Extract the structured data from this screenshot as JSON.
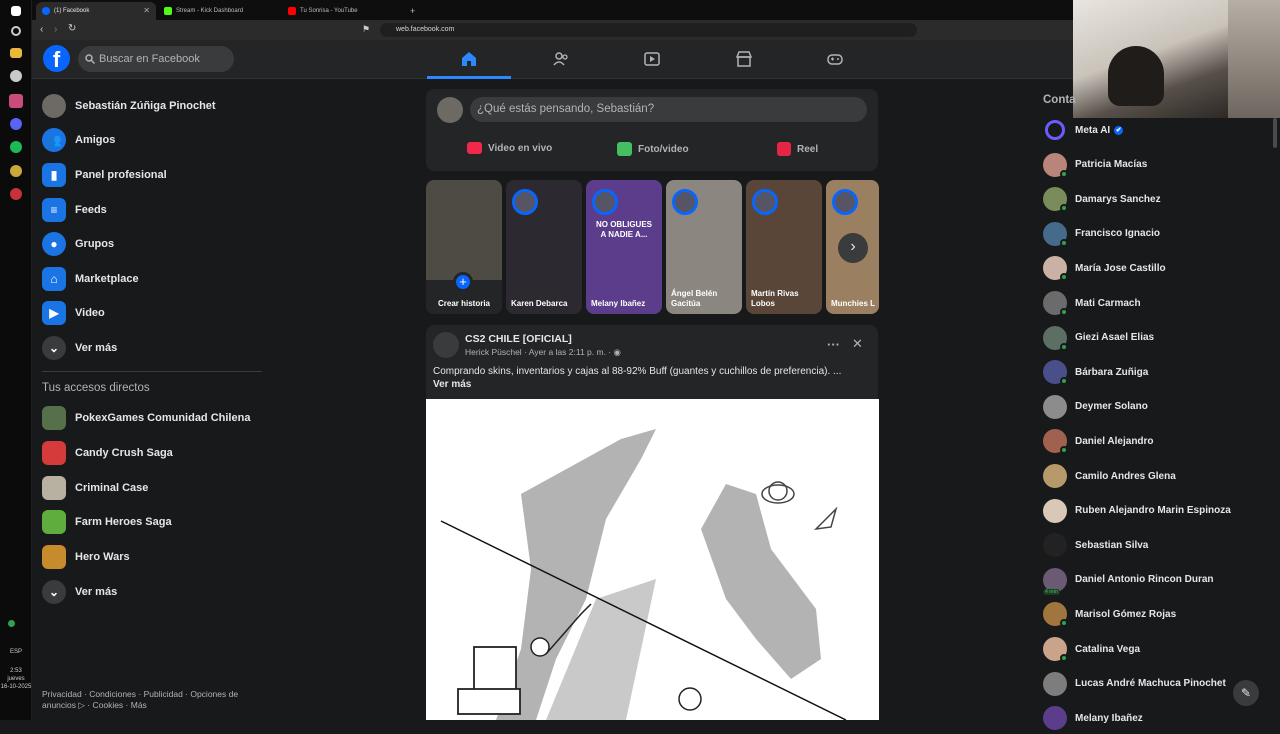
{
  "taskbar": {
    "lang": "ESP",
    "time": "2:53",
    "day": "jueves",
    "date": "16-10-2025"
  },
  "browser": {
    "tabs": [
      {
        "label": "(1) Facebook",
        "color": "#0866ff"
      },
      {
        "label": "Stream - Kick Dashboard",
        "color": "#53fc18"
      },
      {
        "label": "Tu Sonrisa - YouTube",
        "color": "#ff0000"
      }
    ],
    "new_tab": "+",
    "url": "web.facebook.com"
  },
  "header": {
    "logo": "f",
    "search_placeholder": "Buscar en Facebook"
  },
  "left": {
    "items": [
      {
        "label": "Sebastián Zúñiga Pinochet",
        "icon": "avatar",
        "color": "#6d6a64"
      },
      {
        "label": "Amigos",
        "icon": "friends-icon",
        "color": "#1b74e4"
      },
      {
        "label": "Panel profesional",
        "icon": "dashboard-icon",
        "color": "#1b74e4"
      },
      {
        "label": "Feeds",
        "icon": "feeds-icon",
        "color": "#1b74e4"
      },
      {
        "label": "Grupos",
        "icon": "groups-icon",
        "color": "#1b74e4"
      },
      {
        "label": "Marketplace",
        "icon": "marketplace-icon",
        "color": "#1b74e4"
      },
      {
        "label": "Video",
        "icon": "video-icon",
        "color": "#1b74e4"
      },
      {
        "label": "Ver más",
        "icon": "chevron-down-icon",
        "color": "#3a3b3c"
      }
    ],
    "shortcuts_title": "Tus accesos directos",
    "shortcuts": [
      {
        "label": "PokexGames Comunidad Chilena",
        "color": "#55704a"
      },
      {
        "label": "Candy Crush Saga",
        "color": "#d63b3b"
      },
      {
        "label": "Criminal Case",
        "color": "#b8b0a0"
      },
      {
        "label": "Farm Heroes Saga",
        "color": "#5fae3d"
      },
      {
        "label": "Hero Wars",
        "color": "#c78a2d"
      },
      {
        "label": "Ver más",
        "color": "#3a3b3c"
      }
    ],
    "footer": "Privacidad · Condiciones · Publicidad · Opciones de anuncios ▷ · Cookies · Más"
  },
  "composer": {
    "placeholder": "¿Qué estás pensando, Sebastián?",
    "buttons": [
      {
        "label": "Video en vivo",
        "color": "#f02849"
      },
      {
        "label": "Foto/video",
        "color": "#45bd62"
      },
      {
        "label": "Reel",
        "color": "#e42645"
      }
    ]
  },
  "stories": [
    {
      "label": "Crear historia",
      "color": "#4e4a44"
    },
    {
      "label": "Karen Debarca",
      "color": "#2c2a30"
    },
    {
      "label": "Melany Ibañez",
      "color": "#5b3d8c",
      "overlay": "NO OBLIGUES A NADIE A..."
    },
    {
      "label": "Ángel Belén Gacitúa",
      "color": "#8b8680"
    },
    {
      "label": "Martín Rivas Lobos",
      "color": "#5a4638"
    },
    {
      "label": "Munchies L",
      "color": "#9a8060"
    }
  ],
  "post": {
    "page": "CS2 CHILE [OFICIAL]",
    "meta": "Herick Püschel · Ayer a las 2:11 p. m. · ",
    "text": "Comprando skins, inventarios y cajas al 88-92% Buff (guantes y cuchillos de preferencia). ...",
    "more": "Ver más"
  },
  "contacts": {
    "title": "Conta",
    "list": [
      {
        "name": "Meta AI",
        "color": "#6b5cff",
        "online": false
      },
      {
        "name": "Patricia Macías",
        "color": "#b9857a",
        "online": true
      },
      {
        "name": "Damarys Sanchez",
        "color": "#7a8c5a",
        "online": true
      },
      {
        "name": "Francisco Ignacio",
        "color": "#456a8a",
        "online": true
      },
      {
        "name": "María Jose Castillo",
        "color": "#c9b2a4",
        "online": true
      },
      {
        "name": "Mati Carmach",
        "color": "#6b6b6b",
        "online": true
      },
      {
        "name": "Giezi Asael Elias",
        "color": "#5d6e64",
        "online": true
      },
      {
        "name": "Bárbara Zuñiga",
        "color": "#4a4f8a",
        "online": true
      },
      {
        "name": "Deymer Solano",
        "color": "#8c8c8c",
        "online": false
      },
      {
        "name": "Daniel Alejandro",
        "color": "#a0624e",
        "online": true
      },
      {
        "name": "Camilo Andres Glena",
        "color": "#b89a6a",
        "online": false
      },
      {
        "name": "Ruben Alejandro Marin Espinoza",
        "color": "#d9c8b8",
        "online": false
      },
      {
        "name": "Sebastian Silva",
        "color": "#222222",
        "online": false
      },
      {
        "name": "Daniel Antonio Rincon Duran",
        "color": "#6a5a74",
        "online": false,
        "badge": "4 min"
      },
      {
        "name": "Marisol Gómez Rojas",
        "color": "#a0763e",
        "online": true
      },
      {
        "name": "Catalina Vega",
        "color": "#c9a48a",
        "online": true
      },
      {
        "name": "Lucas André Machuca Pinochet",
        "color": "#7d7d7d",
        "online": false
      },
      {
        "name": "Melany Ibañez",
        "color": "#5b3d8c",
        "online": false
      }
    ]
  }
}
